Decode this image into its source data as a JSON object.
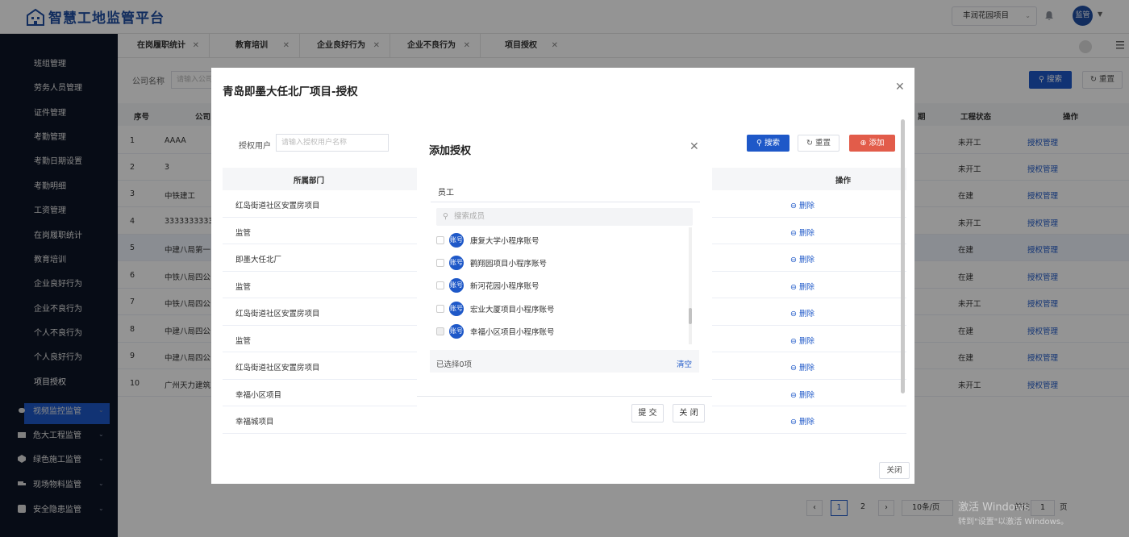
{
  "app": {
    "title": "智慧工地监管平台",
    "project_selector": "丰润花园项目",
    "avatar": "监管"
  },
  "sidebar": {
    "items": [
      "班组管理",
      "劳务人员管理",
      "证件管理",
      "考勤管理",
      "考勤日期设置",
      "考勤明细",
      "工资管理",
      "在岗履职统计",
      "教育培训",
      "企业良好行为",
      "企业不良行为",
      "个人不良行为",
      "个人良好行为",
      "项目授权"
    ],
    "active": "项目授权",
    "groups": [
      "视频监控监管",
      "危大工程监管",
      "绿色施工监管",
      "现场物料监管",
      "安全隐患监管"
    ]
  },
  "tabs": [
    "在岗履职统计",
    "教育培训",
    "企业良好行为",
    "企业不良行为",
    "项目授权"
  ],
  "query": {
    "company_label": "公司名称",
    "company_placeholder": "请输入公司",
    "search": "搜索",
    "reset": "重置"
  },
  "table": {
    "headers": [
      "序号",
      "公司",
      "期",
      "工程状态",
      "操作"
    ],
    "rows": [
      {
        "no": "1",
        "company": "AAAA",
        "status": "未开工",
        "op": "授权管理"
      },
      {
        "no": "2",
        "company": "3",
        "status": "未开工",
        "op": "授权管理"
      },
      {
        "no": "3",
        "company": "中铁建工",
        "status": "在建",
        "op": "授权管理"
      },
      {
        "no": "4",
        "company": "3333333333",
        "status": "未开工",
        "op": "授权管理"
      },
      {
        "no": "5",
        "company": "中建八局第一",
        "status": "在建",
        "op": "授权管理"
      },
      {
        "no": "6",
        "company": "中铁八局四公",
        "status": "在建",
        "op": "授权管理"
      },
      {
        "no": "7",
        "company": "中铁八局四公",
        "status": "未开工",
        "op": "授权管理"
      },
      {
        "no": "8",
        "company": "中建八局四公",
        "status": "在建",
        "op": "授权管理"
      },
      {
        "no": "9",
        "company": "中建八局四公",
        "status": "在建",
        "op": "授权管理"
      },
      {
        "no": "10",
        "company": "广州天力建筑",
        "status": "未开工",
        "op": "授权管理"
      }
    ]
  },
  "pagination": {
    "pages": [
      "1",
      "2"
    ],
    "current": "1",
    "page_size": "10条/页",
    "goto_label": "前往",
    "goto_value": "1",
    "page_unit": "页"
  },
  "auth_dialog": {
    "title": "青岛即墨大任北厂项目-授权",
    "user_label": "授权用户",
    "user_placeholder": "请输入授权用户名称",
    "search": "搜索",
    "reset": "重置",
    "add": "添加",
    "headers": [
      "所属部门",
      "操作"
    ],
    "rows": [
      {
        "dept": "红岛街道社区安置房项目",
        "op": "删除"
      },
      {
        "dept": "监管",
        "op": "删除"
      },
      {
        "dept": "即墨大任北厂",
        "op": "删除"
      },
      {
        "dept": "监管",
        "op": "删除"
      },
      {
        "dept": "红岛街道社区安置房项目",
        "op": "删除"
      },
      {
        "dept": "监管",
        "op": "删除"
      },
      {
        "dept": "红岛街道社区安置房项目",
        "op": "删除"
      },
      {
        "dept": "幸福小区项目",
        "op": "删除"
      },
      {
        "dept": "幸福城项目",
        "op": "删除"
      }
    ],
    "close": "关闭"
  },
  "add_dialog": {
    "title": "添加授权",
    "tab": "员工",
    "search_placeholder": "搜索成员",
    "avatar_text": "账号",
    "members": [
      "康复大学小程序账号",
      "鹳翔园项目小程序账号",
      "新河花园小程序账号",
      "宏业大厦项目小程序账号",
      "幸福小区项目小程序账号"
    ],
    "selected_text": "已选择0项",
    "clear": "清空",
    "submit": "提 交",
    "close": "关 闭"
  },
  "watermark": {
    "line1": "激活 Windows",
    "line2": "转到\"设置\"以激活 Windows。"
  },
  "colors": {
    "primary": "#1e58c8",
    "sidebar": "#0d1526",
    "danger": "#e25c4a"
  }
}
